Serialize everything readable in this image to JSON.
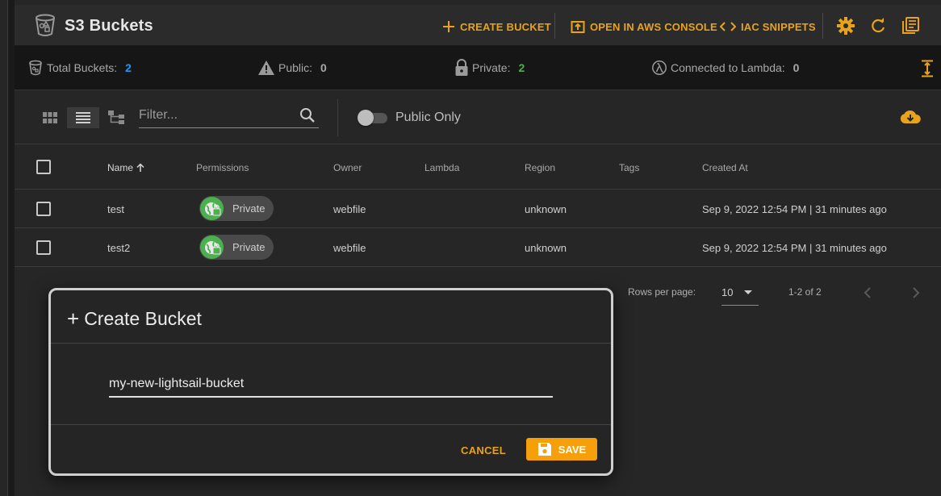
{
  "header": {
    "title": "S3 Buckets",
    "create_label": "CREATE BUCKET",
    "console_label": "OPEN IN AWS CONSOLE",
    "iac_label": "IAC SNIPPETS"
  },
  "stats": {
    "total_label": "Total Buckets:",
    "total_value": "2",
    "public_label": "Public:",
    "public_value": "0",
    "private_label": "Private:",
    "private_value": "2",
    "lambda_label": "Connected to Lambda:",
    "lambda_value": "0"
  },
  "toolbar": {
    "filter_placeholder": "Filter...",
    "public_only_label": "Public Only"
  },
  "table": {
    "columns": [
      "Name",
      "Permissions",
      "Owner",
      "Lambda",
      "Region",
      "Tags",
      "Created At"
    ],
    "sort_icon": "arrow-up-icon",
    "rows": [
      {
        "name": "test",
        "permission": "Private",
        "owner": "webfile",
        "lambda": "",
        "region": "unknown",
        "tags": "",
        "created": "Sep 9, 2022 12:54 PM | 31 minutes ago"
      },
      {
        "name": "test2",
        "permission": "Private",
        "owner": "webfile",
        "lambda": "",
        "region": "unknown",
        "tags": "",
        "created": "Sep 9, 2022 12:54 PM | 31 minutes ago"
      }
    ]
  },
  "pagination": {
    "rows_per_page_label": "Rows per page:",
    "rows_per_page_value": "10",
    "range": "1-2 of 2"
  },
  "dialog": {
    "plus": "+",
    "title": "Create Bucket",
    "input_value": "my-new-lightsail-bucket",
    "cancel_label": "CANCEL",
    "save_label": "SAVE"
  },
  "colors": {
    "accent": "#e8a31c",
    "total_value": "#2196f3",
    "private_value": "#4caf50",
    "save_bg": "#f5a00a"
  }
}
